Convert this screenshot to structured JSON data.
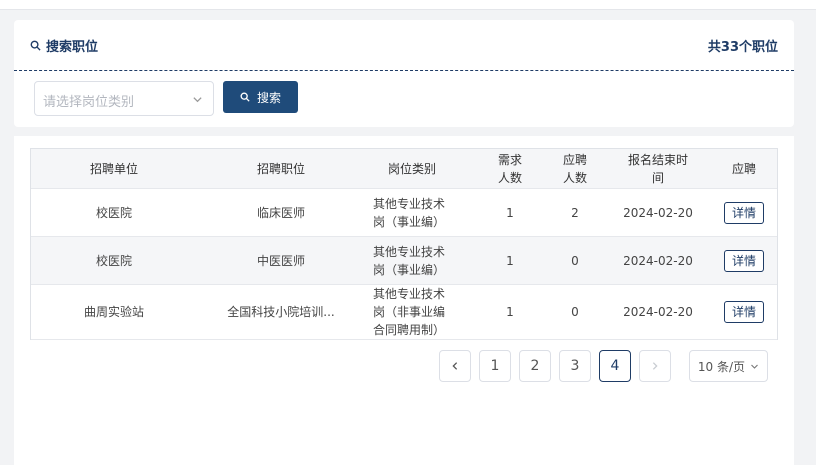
{
  "search": {
    "title": "搜索职位",
    "total": "共33个职位",
    "select_placeholder": "请选择岗位类别",
    "button_label": "搜索"
  },
  "table": {
    "headers": {
      "unit": "招聘单位",
      "position": "招聘职位",
      "category": "岗位类别",
      "demand_1": "需求",
      "demand_2": "人数",
      "applied_1": "应聘",
      "applied_2": "人数",
      "deadline_1": "报名结束时",
      "deadline_2": "间",
      "apply": "应聘"
    },
    "rows": [
      {
        "unit": "校医院",
        "position": "临床医师",
        "category_1": "其他专业技术",
        "category_2": "岗（事业编）",
        "category_3": "",
        "demand": "1",
        "applied": "2",
        "deadline": "2024-02-20",
        "action": "详情"
      },
      {
        "unit": "校医院",
        "position": "中医医师",
        "category_1": "其他专业技术",
        "category_2": "岗（事业编）",
        "category_3": "",
        "demand": "1",
        "applied": "0",
        "deadline": "2024-02-20",
        "action": "详情"
      },
      {
        "unit": "曲周实验站",
        "position": "全国科技小院培训...",
        "category_1": "其他专业技术",
        "category_2": "岗（非事业编",
        "category_3": "合同聘用制）",
        "demand": "1",
        "applied": "0",
        "deadline": "2024-02-20",
        "action": "详情"
      }
    ]
  },
  "pagination": {
    "prev": "‹",
    "pages": [
      "1",
      "2",
      "3",
      "4"
    ],
    "current": "4",
    "next": "›",
    "page_size": "10 条/页"
  },
  "icons": [
    "search-icon",
    "chevron-down-icon",
    "chevron-left-icon",
    "chevron-right-icon"
  ],
  "colors": {
    "primary": "#1f4b7a",
    "title": "#1f3c66"
  }
}
